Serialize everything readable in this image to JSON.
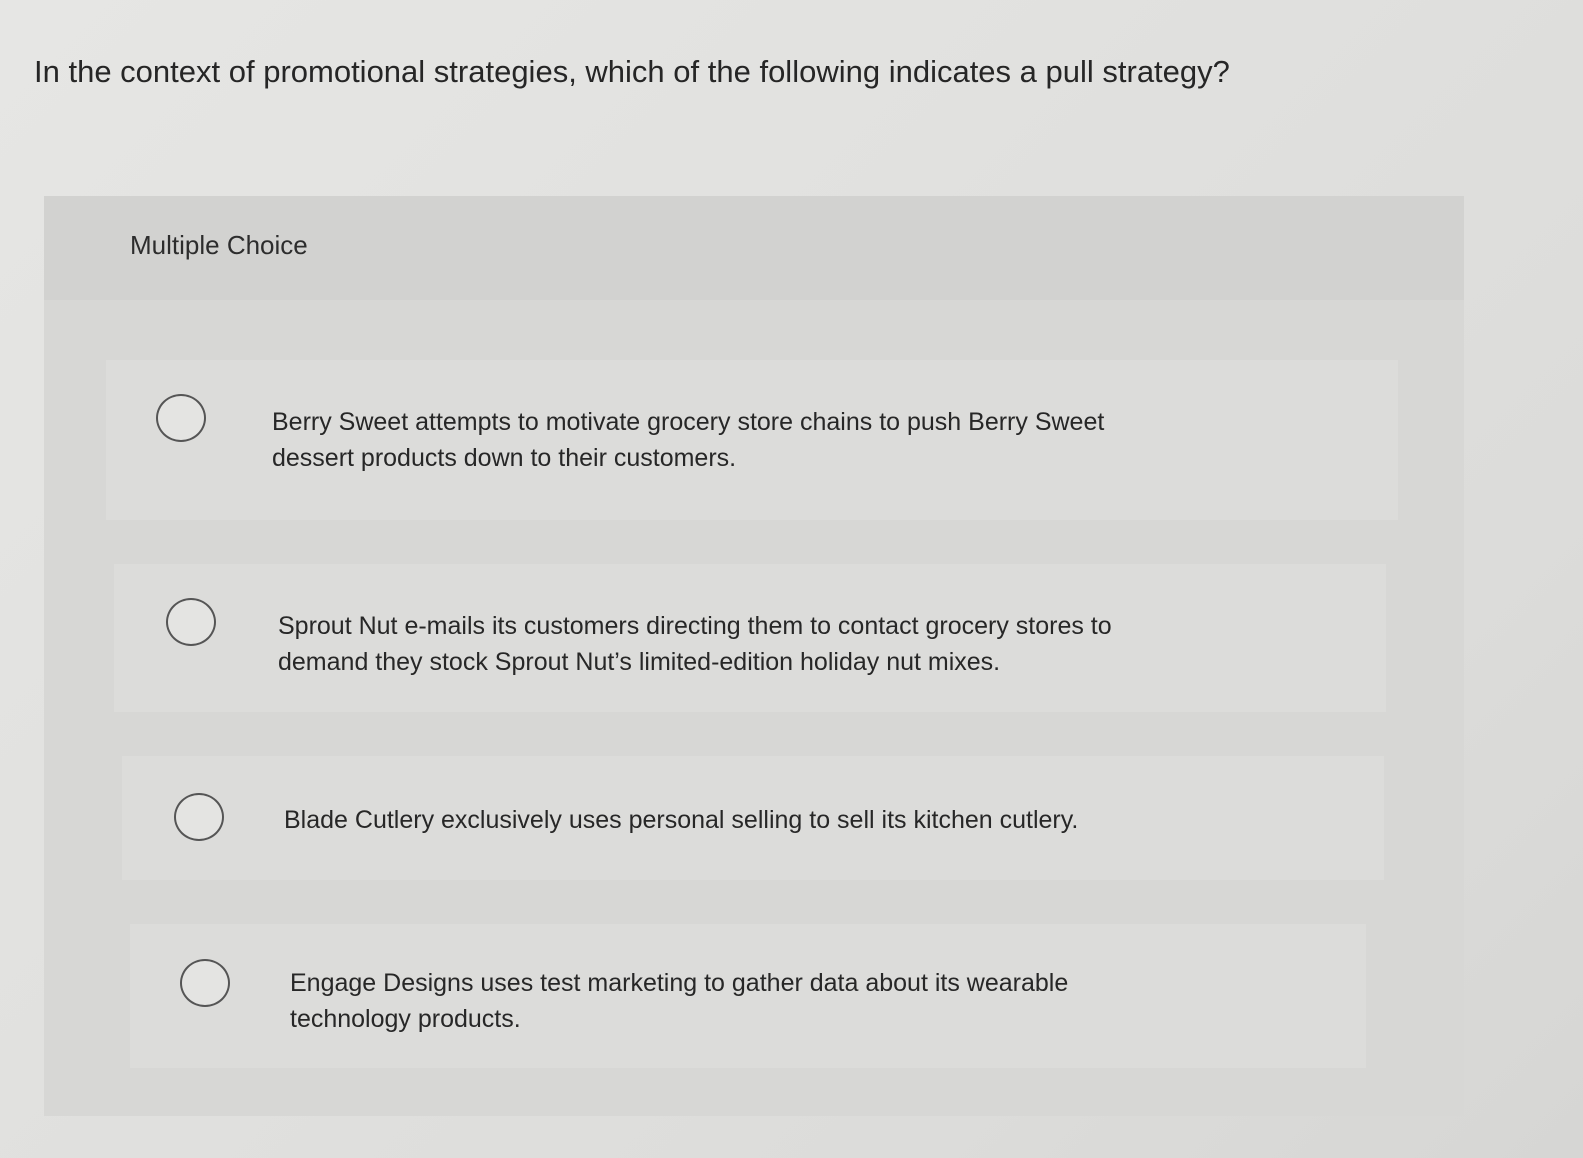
{
  "question": "In the context of promotional strategies, which of the following indicates a pull strategy?",
  "section_label": "Multiple Choice",
  "options": [
    {
      "text": "Berry Sweet attempts to motivate grocery store chains to push Berry Sweet dessert products down to their customers."
    },
    {
      "text": "Sprout Nut e-mails its customers directing them to contact grocery stores to demand they stock Sprout Nut’s limited-edition holiday nut mixes."
    },
    {
      "text": "Blade Cutlery exclusively uses personal selling to sell its kitchen cutlery."
    },
    {
      "text": "Engage Designs uses test marketing to gather data about its wearable technology products."
    }
  ],
  "colors": {
    "background": "#e1e1df",
    "panel": "#d7d7d5",
    "text": "#272727",
    "radio_border": "#555555"
  }
}
